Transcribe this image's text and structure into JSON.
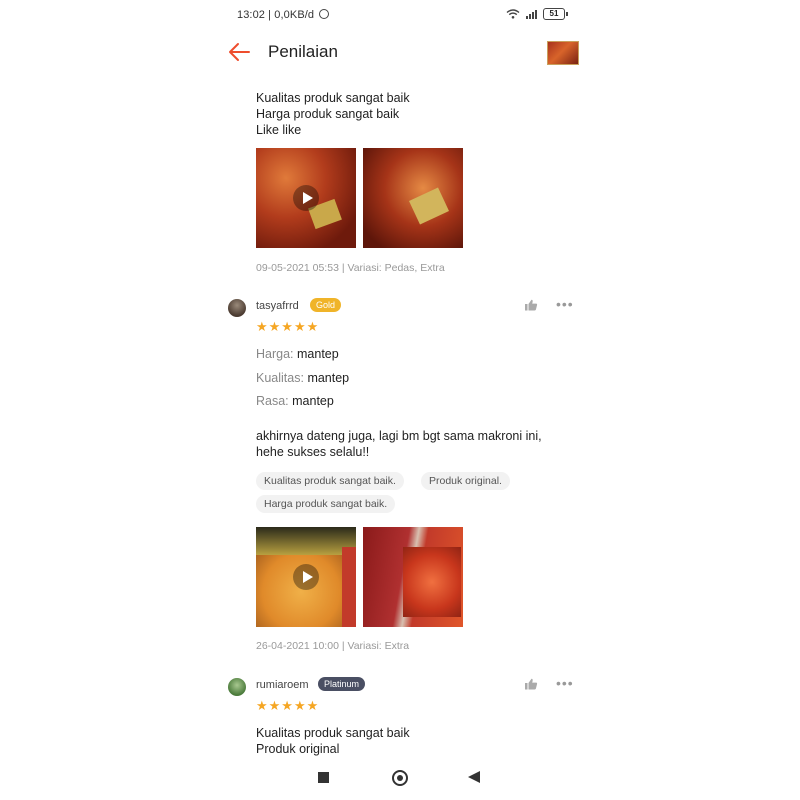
{
  "status_bar": {
    "time_info": "13:02 | 0,0KB/d",
    "battery": "51"
  },
  "header": {
    "title": "Penilaian"
  },
  "review_prev": {
    "lines": [
      "Kualitas produk sangat baik",
      "Harga produk sangat baik",
      "Like like"
    ],
    "meta": "09-05-2021 05:53 | Variasi: Pedas, Extra"
  },
  "review_1": {
    "username": "tasyafrrd",
    "badge": "Gold",
    "stars": "★★★★★",
    "attributes": [
      {
        "key": "Harga:",
        "value": "mantep"
      },
      {
        "key": "Kualitas:",
        "value": "mantep"
      },
      {
        "key": "Rasa:",
        "value": "mantep"
      }
    ],
    "text_line1": "akhirnya dateng juga, lagi bm bgt sama makroni ini,",
    "text_line2": "hehe sukses selalu!!",
    "tags": [
      "Kualitas produk sangat baik.",
      "Produk original.",
      "Harga produk sangat baik."
    ],
    "meta": "26-04-2021 10:00 | Variasi: Extra"
  },
  "review_2": {
    "username": "rumiaroem",
    "badge": "Platinum",
    "stars": "★★★★★",
    "lines": [
      "Kualitas produk sangat baik",
      "Produk original"
    ]
  },
  "colors": {
    "accent": "#ee4d2d",
    "gold_badge": "#f0b429",
    "platinum_badge": "#4a4f63",
    "star": "#f5a623"
  }
}
